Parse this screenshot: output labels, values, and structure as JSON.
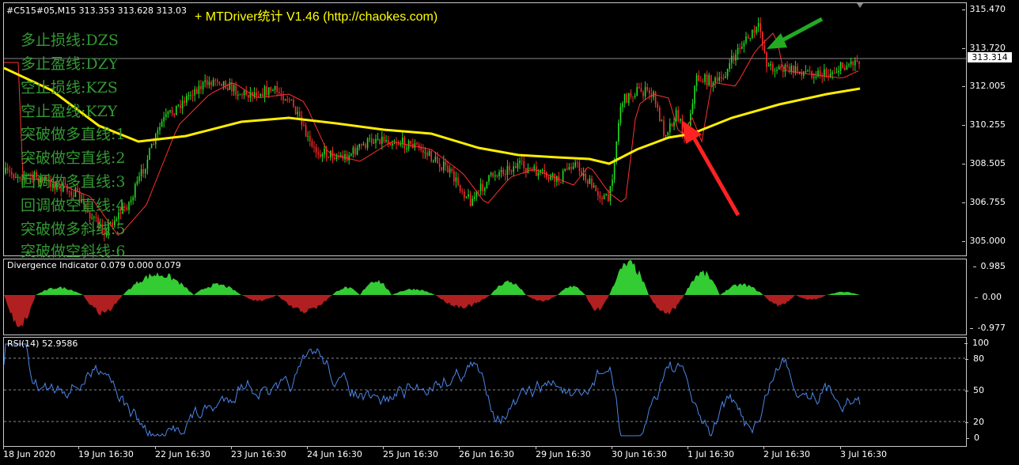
{
  "chart": {
    "symbol_header": "#C515#05,M15  313.353 313.628 313.03",
    "ea_title": "+ MTDriver统计 V1.46  (http://chaokes.com)",
    "legend": [
      "多止损线:DZS",
      "多止盈线:DZY",
      "空止损线:KZS",
      "空止盈线:KZY",
      "突破做多直线:1",
      "突破做空直线:2",
      "回调做多直线:3",
      "回调做空直线:4",
      "突破做多斜线:5",
      "突破做空斜线:6"
    ],
    "price_ticks": [
      "315.470",
      "313.720",
      "312.005",
      "310.255",
      "308.505",
      "306.755",
      "305.000"
    ],
    "current_price": "313.314",
    "colors": {
      "background": "#000000",
      "bull_candle": "#22dd22",
      "bear_candle": "#ff2a2a",
      "ma_slow": "#ffee00",
      "ma_fast": "#ff3030",
      "legend_text": "#339933",
      "hist_positive": "#33cc33",
      "hist_negative": "#b02020",
      "rsi_line": "#4a86e8",
      "arrow_green": "#22aa22",
      "arrow_red": "#ff2222"
    }
  },
  "divergence": {
    "header": "Divergence Indicator 0.079 0.000 0.079",
    "ticks": [
      "0.985",
      "0.00",
      "-0.977"
    ]
  },
  "rsi": {
    "header": "RSI(14) 52.9586",
    "ticks": [
      "100",
      "80",
      "50",
      "20",
      "0"
    ]
  },
  "time_axis": [
    "18 Jun 2020",
    "19 Jun 16:30",
    "22 Jun 16:30",
    "23 Jun 16:30",
    "24 Jun 16:30",
    "25 Jun 16:30",
    "26 Jun 16:30",
    "29 Jun 16:30",
    "30 Jun 16:30",
    "1 Jul 16:30",
    "2 Jul 16:30",
    "3 Jul 16:30"
  ]
}
